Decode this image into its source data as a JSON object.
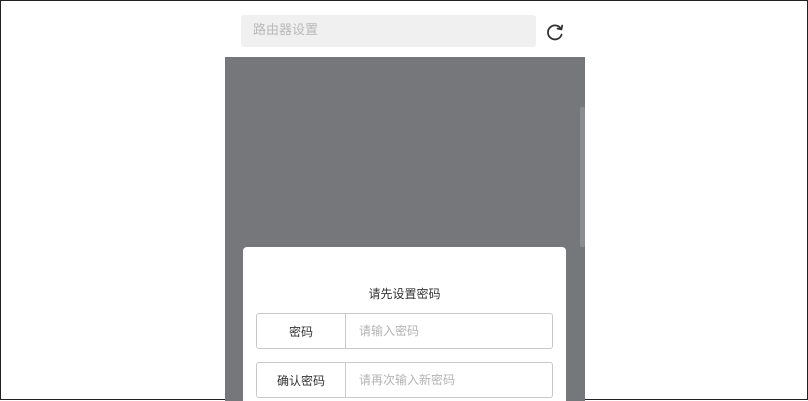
{
  "top_bar": {
    "search_placeholder": "路由器设置",
    "refresh_icon": "refresh-icon"
  },
  "dialog": {
    "title": "请先设置密码",
    "fields": [
      {
        "label": "密码",
        "placeholder": "请输入密码",
        "value": ""
      },
      {
        "label": "确认密码",
        "placeholder": "请再次输入新密码",
        "value": ""
      }
    ]
  },
  "colors": {
    "overlay": "#76777a",
    "search_bg": "#f0f0f0",
    "dialog_bg": "#ffffff",
    "border": "#c9c9c9"
  }
}
